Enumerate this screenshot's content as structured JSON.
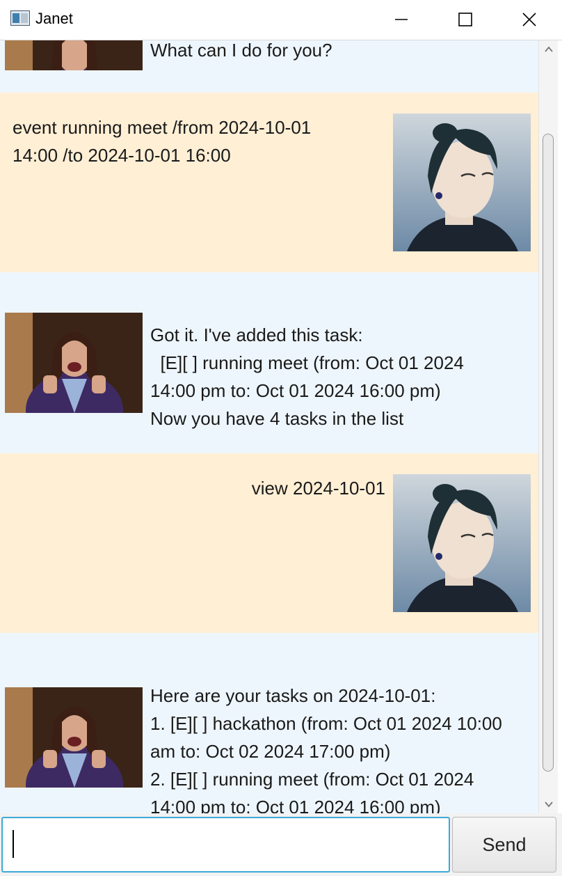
{
  "window": {
    "title": "Janet"
  },
  "conversation": [
    {
      "sender": "bot",
      "text": "What can I do for you?"
    },
    {
      "sender": "user",
      "text": "event running meet /from 2024-10-01\n14:00 /to 2024-10-01 16:00"
    },
    {
      "sender": "bot",
      "text": "Got it. I've added this task:\n  [E][ ] running meet (from: Oct 01 2024\n14:00 pm to: Oct 01 2024 16:00 pm)\nNow you have 4 tasks in the list"
    },
    {
      "sender": "user",
      "text": "view 2024-10-01"
    },
    {
      "sender": "bot",
      "text": "Here are your tasks on 2024-10-01:\n1. [E][ ] hackathon (from: Oct 01 2024 10:00\nam to: Oct 02 2024 17:00 pm)\n2. [E][ ] running meet (from: Oct 01 2024\n14:00 pm to: Oct 01 2024 16:00 pm)"
    }
  ],
  "input": {
    "value": "",
    "placeholder": ""
  },
  "send_button": {
    "label": "Send"
  },
  "icons": {
    "app": "app-window-icon",
    "minimize": "minimize-icon",
    "maximize": "maximize-icon",
    "close": "close-icon"
  },
  "colors": {
    "bot_bubble": "#eef6fd",
    "user_bubble": "#ffefd5",
    "input_focus": "#3ca9d6"
  }
}
